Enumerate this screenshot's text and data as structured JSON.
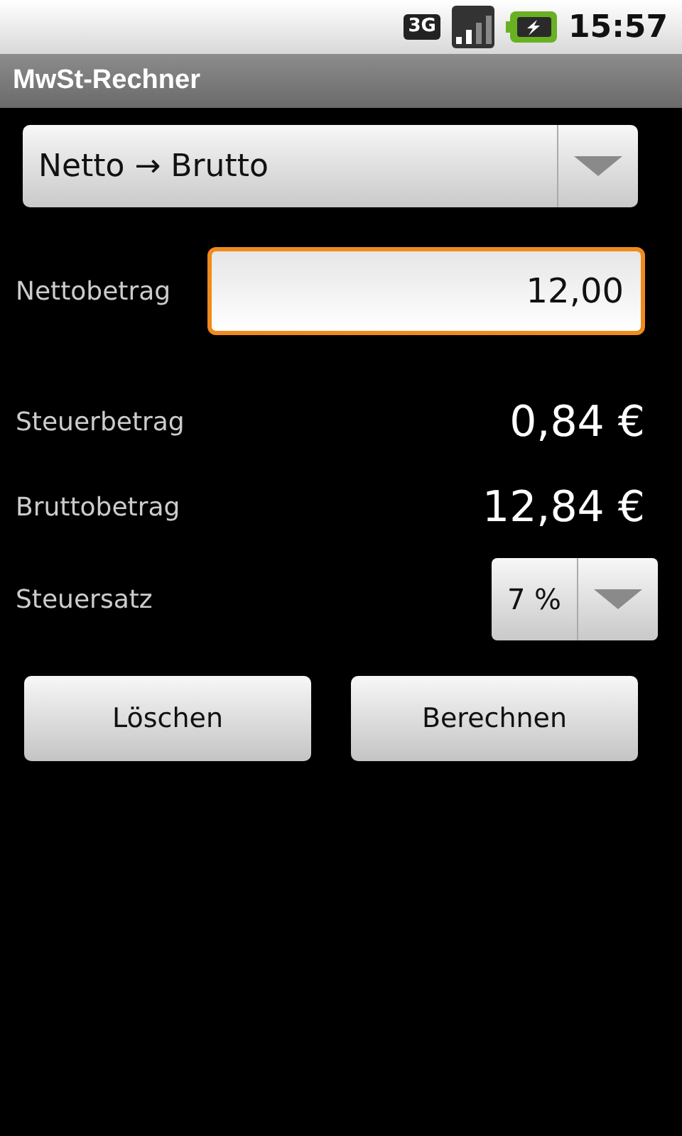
{
  "status_bar": {
    "network": "3G",
    "time": "15:57"
  },
  "title": "MwSt-Rechner",
  "mode_spinner": {
    "value": "Netto → Brutto"
  },
  "net_field": {
    "label": "Nettobetrag",
    "value": "12,00",
    "focused": true
  },
  "results": [
    {
      "label": "Steuerbetrag",
      "value": "0,84 €"
    },
    {
      "label": "Bruttobetrag",
      "value": "12,84 €"
    }
  ],
  "rate": {
    "label": "Steuersatz",
    "value": "7 %"
  },
  "buttons": [
    "Löschen",
    "Berechnen"
  ]
}
